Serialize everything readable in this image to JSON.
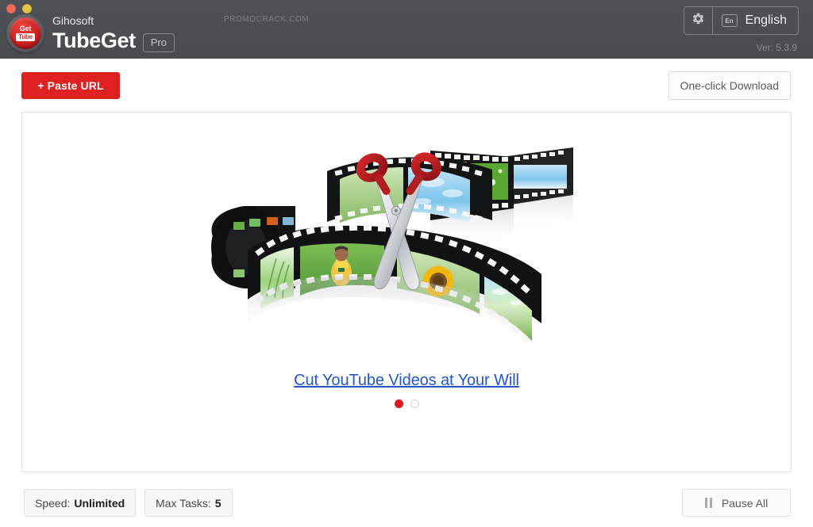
{
  "window": {
    "traffic_lights": [
      "close",
      "minimize"
    ]
  },
  "header": {
    "company": "Gihosoft",
    "product": "TubeGet",
    "edition_badge": "Pro",
    "watermark": "PROMOCRACK.COM",
    "logo": {
      "top_text": "Get",
      "bottom_text": "Tube"
    },
    "settings_icon": "gear-icon",
    "language": {
      "badge": "En",
      "label": "English"
    },
    "version": "Ver: 5.3.9",
    "bg_color": "#4b4e53"
  },
  "toolbar": {
    "paste_url_label": "+ Paste URL",
    "paste_url_color": "#dd2020",
    "one_click_download_label": "One-click Download"
  },
  "main": {
    "promo": {
      "link_text": "Cut YouTube Videos at Your Will",
      "link_color": "#2457c5",
      "illustration": "film-strip-with-scissors",
      "dots": [
        {
          "state": "active",
          "color": "#dd1b1b"
        },
        {
          "state": "idle",
          "color": "#ffffff"
        }
      ]
    }
  },
  "statusbar": {
    "speed": {
      "key": "Speed:",
      "value": "Unlimited"
    },
    "max_tasks": {
      "key": "Max Tasks:",
      "value": "5"
    },
    "pause_all_label": "Pause All",
    "pause_icon": "pause-icon"
  }
}
